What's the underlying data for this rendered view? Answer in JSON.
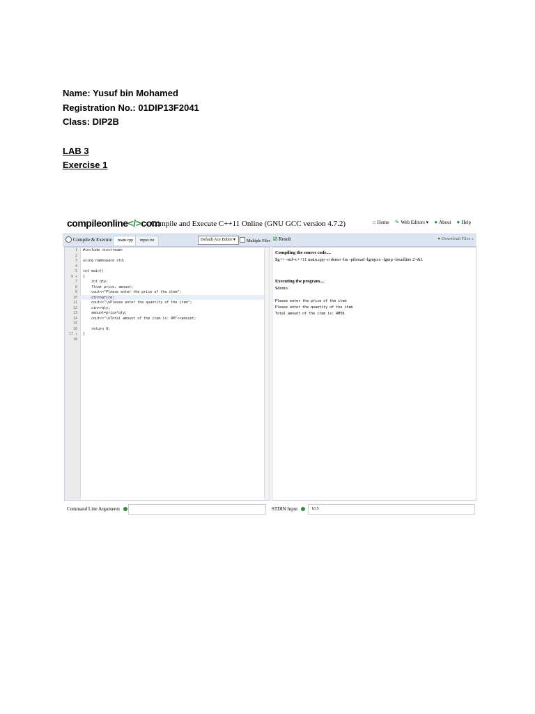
{
  "doc": {
    "name": "Name: Yusuf bin Mohamed",
    "reg": "Registration No.: 01DIP13F2041",
    "class": "Class: DIP2B",
    "lab": "LAB 3",
    "exercise": "Exercise 1"
  },
  "site": {
    "logo_left": "compileonline",
    "logo_bracket": "</>",
    "logo_right": "com",
    "title": "- Compile and Execute C++11 Online (GNU GCC version 4.7.2)",
    "nav": [
      "Home",
      "Web Editors ▾",
      "About",
      "Help"
    ]
  },
  "toolbar": {
    "compile": "Compile & Execute",
    "tab1": "main.cpp",
    "tab2": "input.txt",
    "editor_mode": "Default Ace Editor ▾",
    "multiple_files": "Multiple Files",
    "result": "Result",
    "download": "Download Files"
  },
  "code": {
    "lines": [
      "#include <iostream>",
      "",
      "using namespace std;",
      "",
      "int main()",
      "{",
      "    int qty;",
      "    float price, amount;",
      "    cout<<\"Please enter the price of the item\";",
      "    cin>>price;",
      "    cout<<\"\\nPlease enter the quantity of the item\";",
      "    cin>>qty;",
      "    amount=price*qty;",
      "    cout<<\"\\nTotal amount of the item is: RM\"<<amount;",
      "",
      "    return 0;",
      "}",
      ""
    ],
    "line_numbers": [
      "1",
      "2",
      "3",
      "4",
      "5",
      "6 ▾",
      "7",
      "8",
      "9",
      "10",
      "11",
      "12",
      "13",
      "14",
      "15",
      "16",
      "17 ▴",
      "18"
    ]
  },
  "result": {
    "compiling": "Compiling the source code....",
    "command": "$g++ -std=c++11 main.cpp -o demo -lm -pthread -lgmpxx -lgmp -lreadline 2>&1",
    "executing": "Executing the program....",
    "demo": "$demo",
    "out1": "Please enter the price of the item",
    "out2": "Please enter the quantity of the item",
    "out3": "Total amount of the item is: RM50"
  },
  "bottom": {
    "cla_label": "Command Line Arguments",
    "cla_value": "",
    "stdin_label": "STDIN Input",
    "stdin_value": "10 5"
  }
}
